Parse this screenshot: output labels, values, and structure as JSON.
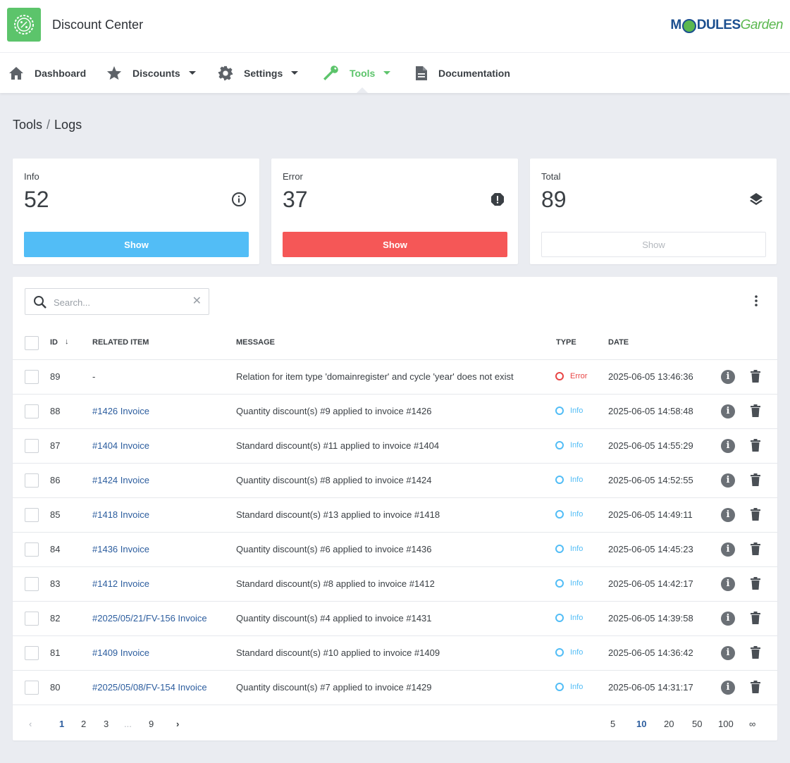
{
  "app": {
    "title": "Discount Center",
    "brand_part1": "M",
    "brand_part2": "DULES",
    "brand_part3": "Garden"
  },
  "nav": {
    "dashboard": "Dashboard",
    "discounts": "Discounts",
    "settings": "Settings",
    "tools": "Tools",
    "documentation": "Documentation"
  },
  "breadcrumb": {
    "parent": "Tools",
    "separator": "/",
    "current": "Logs"
  },
  "stats": {
    "info": {
      "label": "Info",
      "value": "52",
      "button": "Show"
    },
    "error": {
      "label": "Error",
      "value": "37",
      "button": "Show"
    },
    "total": {
      "label": "Total",
      "value": "89",
      "button": "Show"
    }
  },
  "search": {
    "placeholder": "Search...",
    "value": "",
    "clear": "✕"
  },
  "table": {
    "headers": {
      "id": "ID",
      "sort": "↓",
      "related": "RELATED ITEM",
      "message": "MESSAGE",
      "type": "TYPE",
      "date": "DATE"
    },
    "rows": [
      {
        "id": "89",
        "related": "-",
        "message": "Relation for item type 'domainregister' and cycle 'year' does not exist",
        "type": "Error",
        "date": "2025-06-05 13:46:36"
      },
      {
        "id": "88",
        "related": "#1426 Invoice",
        "message": "Quantity discount(s) #9 applied to invoice #1426",
        "type": "Info",
        "date": "2025-06-05 14:58:48"
      },
      {
        "id": "87",
        "related": "#1404 Invoice",
        "message": "Standard discount(s) #11 applied to invoice #1404",
        "type": "Info",
        "date": "2025-06-05 14:55:29"
      },
      {
        "id": "86",
        "related": "#1424 Invoice",
        "message": "Quantity discount(s) #8 applied to invoice #1424",
        "type": "Info",
        "date": "2025-06-05 14:52:55"
      },
      {
        "id": "85",
        "related": "#1418 Invoice",
        "message": "Standard discount(s) #13 applied to invoice #1418",
        "type": "Info",
        "date": "2025-06-05 14:49:11"
      },
      {
        "id": "84",
        "related": "#1436 Invoice",
        "message": "Quantity discount(s) #6 applied to invoice #1436",
        "type": "Info",
        "date": "2025-06-05 14:45:23"
      },
      {
        "id": "83",
        "related": "#1412 Invoice",
        "message": "Standard discount(s) #8 applied to invoice #1412",
        "type": "Info",
        "date": "2025-06-05 14:42:17"
      },
      {
        "id": "82",
        "related": "#2025/05/21/FV-156 Invoice",
        "message": "Quantity discount(s) #4 applied to invoice #1431",
        "type": "Info",
        "date": "2025-06-05 14:39:58"
      },
      {
        "id": "81",
        "related": "#1409 Invoice",
        "message": "Standard discount(s) #10 applied to invoice #1409",
        "type": "Info",
        "date": "2025-06-05 14:36:42"
      },
      {
        "id": "80",
        "related": "#2025/05/08/FV-154 Invoice",
        "message": "Quantity discount(s) #7 applied to invoice #1429",
        "type": "Info",
        "date": "2025-06-05 14:31:17"
      }
    ],
    "info_glyph": "i"
  },
  "pagination": {
    "prev": "‹",
    "next": "›",
    "pages": [
      "1",
      "2",
      "3",
      "...",
      "9"
    ],
    "current_page": "1",
    "per_page": [
      "5",
      "10",
      "20",
      "50",
      "100",
      "∞"
    ],
    "current_per_page": "10"
  },
  "colors": {
    "accent": "#5cc46b",
    "info": "#52bdf6",
    "error": "#f55757",
    "link": "#2c5d9e"
  }
}
